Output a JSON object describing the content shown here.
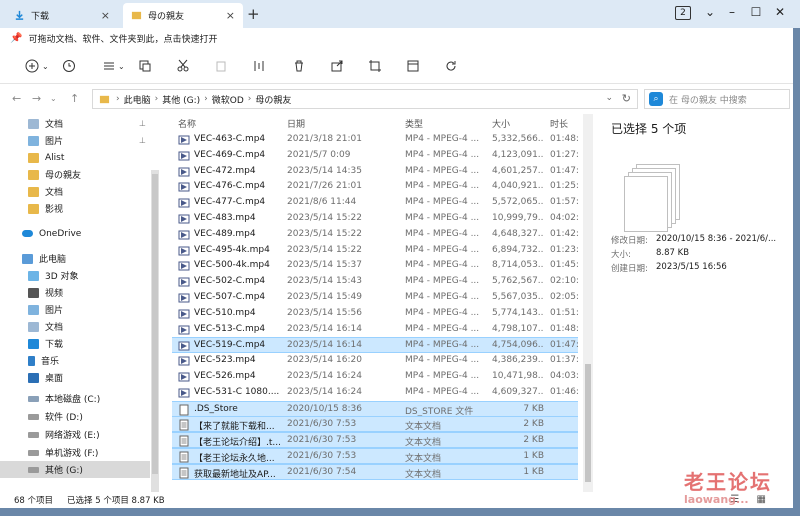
{
  "tabs": [
    {
      "label": "下载"
    },
    {
      "label": "母の親友"
    }
  ],
  "window": {
    "count": "2"
  },
  "hint": "可拖动文档、软件、文件夹到此，点击快速打开",
  "breadcrumb": [
    "此电脑",
    "其他 (G:)",
    "微软OD",
    "母の親友"
  ],
  "search": {
    "placeholder": "在 母の親友 中搜索"
  },
  "sidebar": [
    {
      "label": "文档",
      "pinned": true
    },
    {
      "label": "图片",
      "pinned": true
    },
    {
      "label": "Alist"
    },
    {
      "label": "母の親友"
    },
    {
      "label": "文档"
    },
    {
      "label": "影视"
    },
    {
      "label": "OneDrive"
    },
    {
      "label": "此电脑"
    },
    {
      "label": "3D 对象"
    },
    {
      "label": "视频"
    },
    {
      "label": "图片"
    },
    {
      "label": "文档"
    },
    {
      "label": "下载"
    },
    {
      "label": "音乐"
    },
    {
      "label": "桌面"
    },
    {
      "label": "本地磁盘 (C:)"
    },
    {
      "label": "软件 (D:)"
    },
    {
      "label": "网络游戏 (E:)"
    },
    {
      "label": "单机游戏 (F:)"
    },
    {
      "label": "其他 (G:)"
    }
  ],
  "columns": {
    "name": "名称",
    "date": "日期",
    "type": "类型",
    "size": "大小",
    "duration": "时长"
  },
  "files": [
    {
      "name": "VEC-463-C.mp4",
      "date": "2021/3/18 21:01",
      "type": "MP4 - MPEG-4 ...",
      "size": "5,332,566...",
      "duration": "01:48:",
      "kind": "video",
      "selected": false
    },
    {
      "name": "VEC-469-C.mp4",
      "date": "2021/5/7 0:09",
      "type": "MP4 - MPEG-4 ...",
      "size": "4,123,091...",
      "duration": "01:27:",
      "kind": "video",
      "selected": false
    },
    {
      "name": "VEC-472.mp4",
      "date": "2023/5/14 14:35",
      "type": "MP4 - MPEG-4 ...",
      "size": "4,601,257...",
      "duration": "01:47:",
      "kind": "video",
      "selected": false
    },
    {
      "name": "VEC-476-C.mp4",
      "date": "2021/7/26 21:01",
      "type": "MP4 - MPEG-4 ...",
      "size": "4,040,921...",
      "duration": "01:25:",
      "kind": "video",
      "selected": false
    },
    {
      "name": "VEC-477-C.mp4",
      "date": "2021/8/6 11:44",
      "type": "MP4 - MPEG-4 ...",
      "size": "5,572,065...",
      "duration": "01:57:",
      "kind": "video",
      "selected": false
    },
    {
      "name": "VEC-483.mp4",
      "date": "2023/5/14 15:22",
      "type": "MP4 - MPEG-4 ...",
      "size": "10,999,79...",
      "duration": "04:02:",
      "kind": "video",
      "selected": false
    },
    {
      "name": "VEC-489.mp4",
      "date": "2023/5/14 15:22",
      "type": "MP4 - MPEG-4 ...",
      "size": "4,648,327...",
      "duration": "01:42:",
      "kind": "video",
      "selected": false
    },
    {
      "name": "VEC-495-4k.mp4",
      "date": "2023/5/14 15:22",
      "type": "MP4 - MPEG-4 ...",
      "size": "6,894,732...",
      "duration": "01:23:",
      "kind": "video",
      "selected": false
    },
    {
      "name": "VEC-500-4k.mp4",
      "date": "2023/5/14 15:37",
      "type": "MP4 - MPEG-4 ...",
      "size": "8,714,053...",
      "duration": "01:45:",
      "kind": "video",
      "selected": false
    },
    {
      "name": "VEC-502-C.mp4",
      "date": "2023/5/14 15:43",
      "type": "MP4 - MPEG-4 ...",
      "size": "5,762,567...",
      "duration": "02:10:",
      "kind": "video",
      "selected": false
    },
    {
      "name": "VEC-507-C.mp4",
      "date": "2023/5/14 15:49",
      "type": "MP4 - MPEG-4 ...",
      "size": "5,567,035...",
      "duration": "02:05:",
      "kind": "video",
      "selected": false
    },
    {
      "name": "VEC-510.mp4",
      "date": "2023/5/14 15:56",
      "type": "MP4 - MPEG-4 ...",
      "size": "5,774,143...",
      "duration": "01:51:",
      "kind": "video",
      "selected": false
    },
    {
      "name": "VEC-513-C.mp4",
      "date": "2023/5/14 16:14",
      "type": "MP4 - MPEG-4 ...",
      "size": "4,798,107...",
      "duration": "01:48:",
      "kind": "video",
      "selected": false
    },
    {
      "name": "VEC-519-C.mp4",
      "date": "2023/5/14 16:14",
      "type": "MP4 - MPEG-4 ...",
      "size": "4,754,096...",
      "duration": "01:47:",
      "kind": "video",
      "selected": true
    },
    {
      "name": "VEC-523.mp4",
      "date": "2023/5/14 16:20",
      "type": "MP4 - MPEG-4 ...",
      "size": "4,386,239...",
      "duration": "01:37:",
      "kind": "video",
      "selected": false
    },
    {
      "name": "VEC-526.mp4",
      "date": "2023/5/14 16:24",
      "type": "MP4 - MPEG-4 ...",
      "size": "10,471,98...",
      "duration": "04:03:",
      "kind": "video",
      "selected": false
    },
    {
      "name": "VEC-531-C 1080....",
      "date": "2023/5/14 16:24",
      "type": "MP4 - MPEG-4 ...",
      "size": "4,609,327...",
      "duration": "01:46:",
      "kind": "video",
      "selected": false
    },
    {
      "name": ".DS_Store",
      "date": "2020/10/15 8:36",
      "type": "DS_STORE 文件",
      "size": "7 KB",
      "duration": "",
      "kind": "file",
      "selected": true
    },
    {
      "name": "【来了就能下载和...",
      "date": "2021/6/30 7:53",
      "type": "文本文档",
      "size": "2 KB",
      "duration": "",
      "kind": "text",
      "selected": true
    },
    {
      "name": "【老王论坛介绍】.t...",
      "date": "2021/6/30 7:53",
      "type": "文本文档",
      "size": "2 KB",
      "duration": "",
      "kind": "text",
      "selected": true
    },
    {
      "name": "【老王论坛永久地...",
      "date": "2021/6/30 7:53",
      "type": "文本文档",
      "size": "1 KB",
      "duration": "",
      "kind": "text",
      "selected": true
    },
    {
      "name": "获取最新地址及AP...",
      "date": "2021/6/30 7:54",
      "type": "文本文档",
      "size": "1 KB",
      "duration": "",
      "kind": "text",
      "selected": true
    }
  ],
  "details": {
    "title": "已选择 5 个项",
    "modified_label": "修改日期:",
    "modified_value": "2020/10/15 8:36 - 2021/6/...",
    "size_label": "大小:",
    "size_value": "8.87 KB",
    "created_label": "创建日期:",
    "created_value": "2023/5/15 16:56"
  },
  "status": {
    "count": "68 个项目",
    "selection": "已选择 5 个项目  8.87 KB"
  },
  "watermark": {
    "line1": "老王论坛",
    "line2": "laowang..."
  },
  "colors": {
    "selected_row": "#cce8ff",
    "accent": "#1e88d8"
  }
}
